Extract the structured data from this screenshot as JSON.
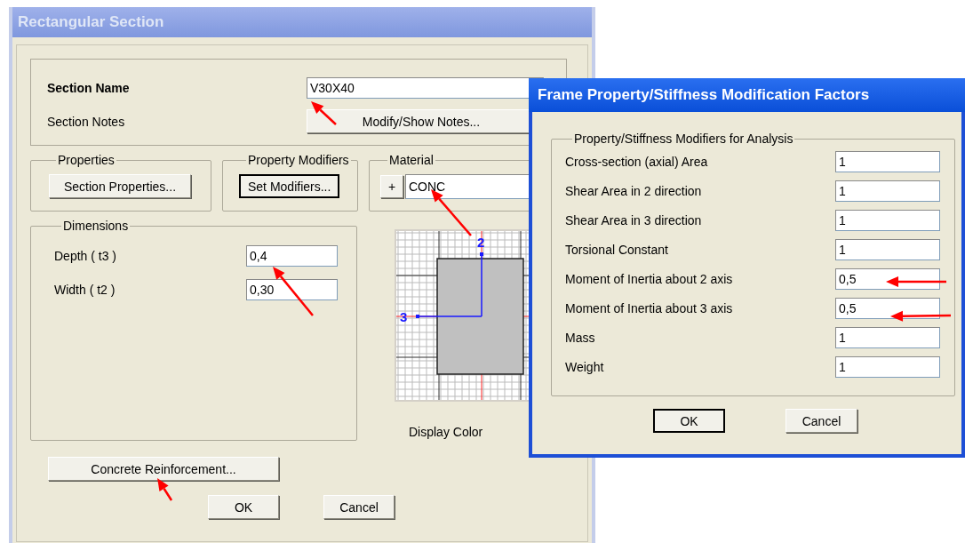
{
  "main_window": {
    "title": "Rectangular Section",
    "active": false,
    "section_name": {
      "label": "Section Name",
      "value": "V30X40"
    },
    "section_notes": {
      "label": "Section Notes",
      "button": "Modify/Show Notes..."
    },
    "properties": {
      "legend": "Properties",
      "button": {
        "label": "Section Properties...",
        "default": false
      }
    },
    "property_modifiers": {
      "legend": "Property Modifiers",
      "button": {
        "label": "Set Modifiers...",
        "default": true
      }
    },
    "material": {
      "legend": "Material",
      "add_button": "+",
      "value": "CONC"
    },
    "dimensions": {
      "legend": "Dimensions",
      "fields": [
        {
          "label": "Depth  ( t3 )",
          "value": "0,4"
        },
        {
          "label": "Width  ( t2 )",
          "value": "0,30"
        }
      ]
    },
    "preview": {
      "axis_labels": [
        "2",
        "3"
      ]
    },
    "display_color": {
      "label": "Display Color"
    },
    "reinforcement_button": {
      "label": "Concrete Reinforcement...",
      "default": false
    },
    "buttons": [
      {
        "label": "OK",
        "default": false
      },
      {
        "label": "Cancel",
        "default": false
      }
    ]
  },
  "modifiers_window": {
    "title": "Frame Property/Stiffness Modification Factors",
    "active": true,
    "legend": "Property/Stiffness Modifiers for Analysis",
    "rows": [
      {
        "label": "Cross-section (axial) Area",
        "value": "1"
      },
      {
        "label": "Shear Area in 2 direction",
        "value": "1"
      },
      {
        "label": "Shear Area in 3 direction",
        "value": "1"
      },
      {
        "label": "Torsional Constant",
        "value": "1"
      },
      {
        "label": "Moment of Inertia about 2 axis",
        "value": "0,5"
      },
      {
        "label": "Moment of Inertia about 3 axis",
        "value": "0,5"
      },
      {
        "label": "Mass",
        "value": "1"
      },
      {
        "label": "Weight",
        "value": "1"
      }
    ],
    "buttons": [
      {
        "label": "OK",
        "default": true
      },
      {
        "label": "Cancel",
        "default": false
      }
    ]
  }
}
